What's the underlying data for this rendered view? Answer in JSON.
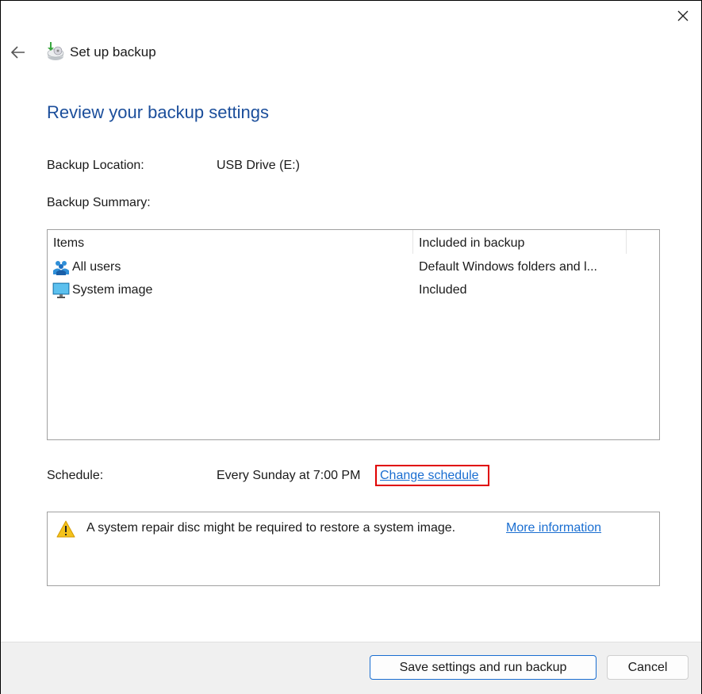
{
  "window": {
    "title": "Set up backup",
    "close_icon": "close-icon",
    "back_icon": "back-arrow-icon",
    "app_icon": "backup-drive-icon"
  },
  "page": {
    "heading": "Review your backup settings",
    "backup_location_label": "Backup Location:",
    "backup_location_value": "USB Drive (E:)",
    "backup_summary_label": "Backup Summary:"
  },
  "summary_table": {
    "columns": [
      "Items",
      "Included in backup"
    ],
    "rows": [
      {
        "icon": "users-icon",
        "item": "All users",
        "included": "Default Windows folders and l..."
      },
      {
        "icon": "monitor-icon",
        "item": "System image",
        "included": "Included"
      }
    ]
  },
  "schedule": {
    "label": "Schedule:",
    "value": "Every Sunday at 7:00 PM",
    "change_link": "Change schedule"
  },
  "notice": {
    "icon": "warning-icon",
    "text": "A system repair disc might be required to restore a system image.",
    "link": "More information"
  },
  "footer": {
    "primary_button": "Save settings and run backup",
    "cancel_button": "Cancel"
  },
  "colors": {
    "heading": "#1b4e9b",
    "link": "#1a6ed1",
    "highlight": "#e00000"
  }
}
